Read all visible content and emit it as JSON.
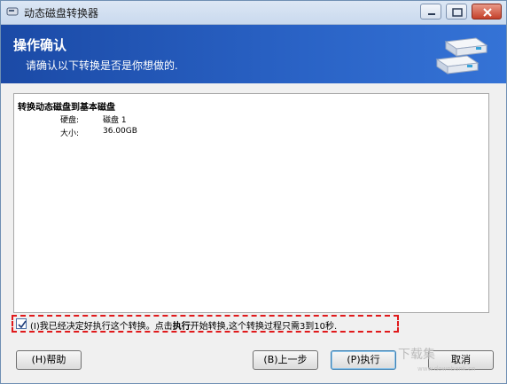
{
  "window": {
    "title": "动态磁盘转换器"
  },
  "header": {
    "title": "操作确认",
    "subtitle": "请确认以下转换是否是你想做的."
  },
  "content": {
    "operation_title": "转换动态磁盘到基本磁盘",
    "rows": [
      {
        "label": "硬盘:",
        "value": "磁盘 1"
      },
      {
        "label": "大小:",
        "value": "36.00GB"
      }
    ]
  },
  "confirm": {
    "checked": true,
    "prefix": "(I)我已经决定好执行这个转换。点击",
    "bold": "执行",
    "suffix": "开始转换,这个转换过程只需3到10秒."
  },
  "buttons": {
    "help": "(H)帮助",
    "back": "(B)上一步",
    "execute": "(P)执行",
    "cancel": "取消"
  },
  "watermark": {
    "text": "下载集",
    "sub": "www.downbank.cn"
  }
}
